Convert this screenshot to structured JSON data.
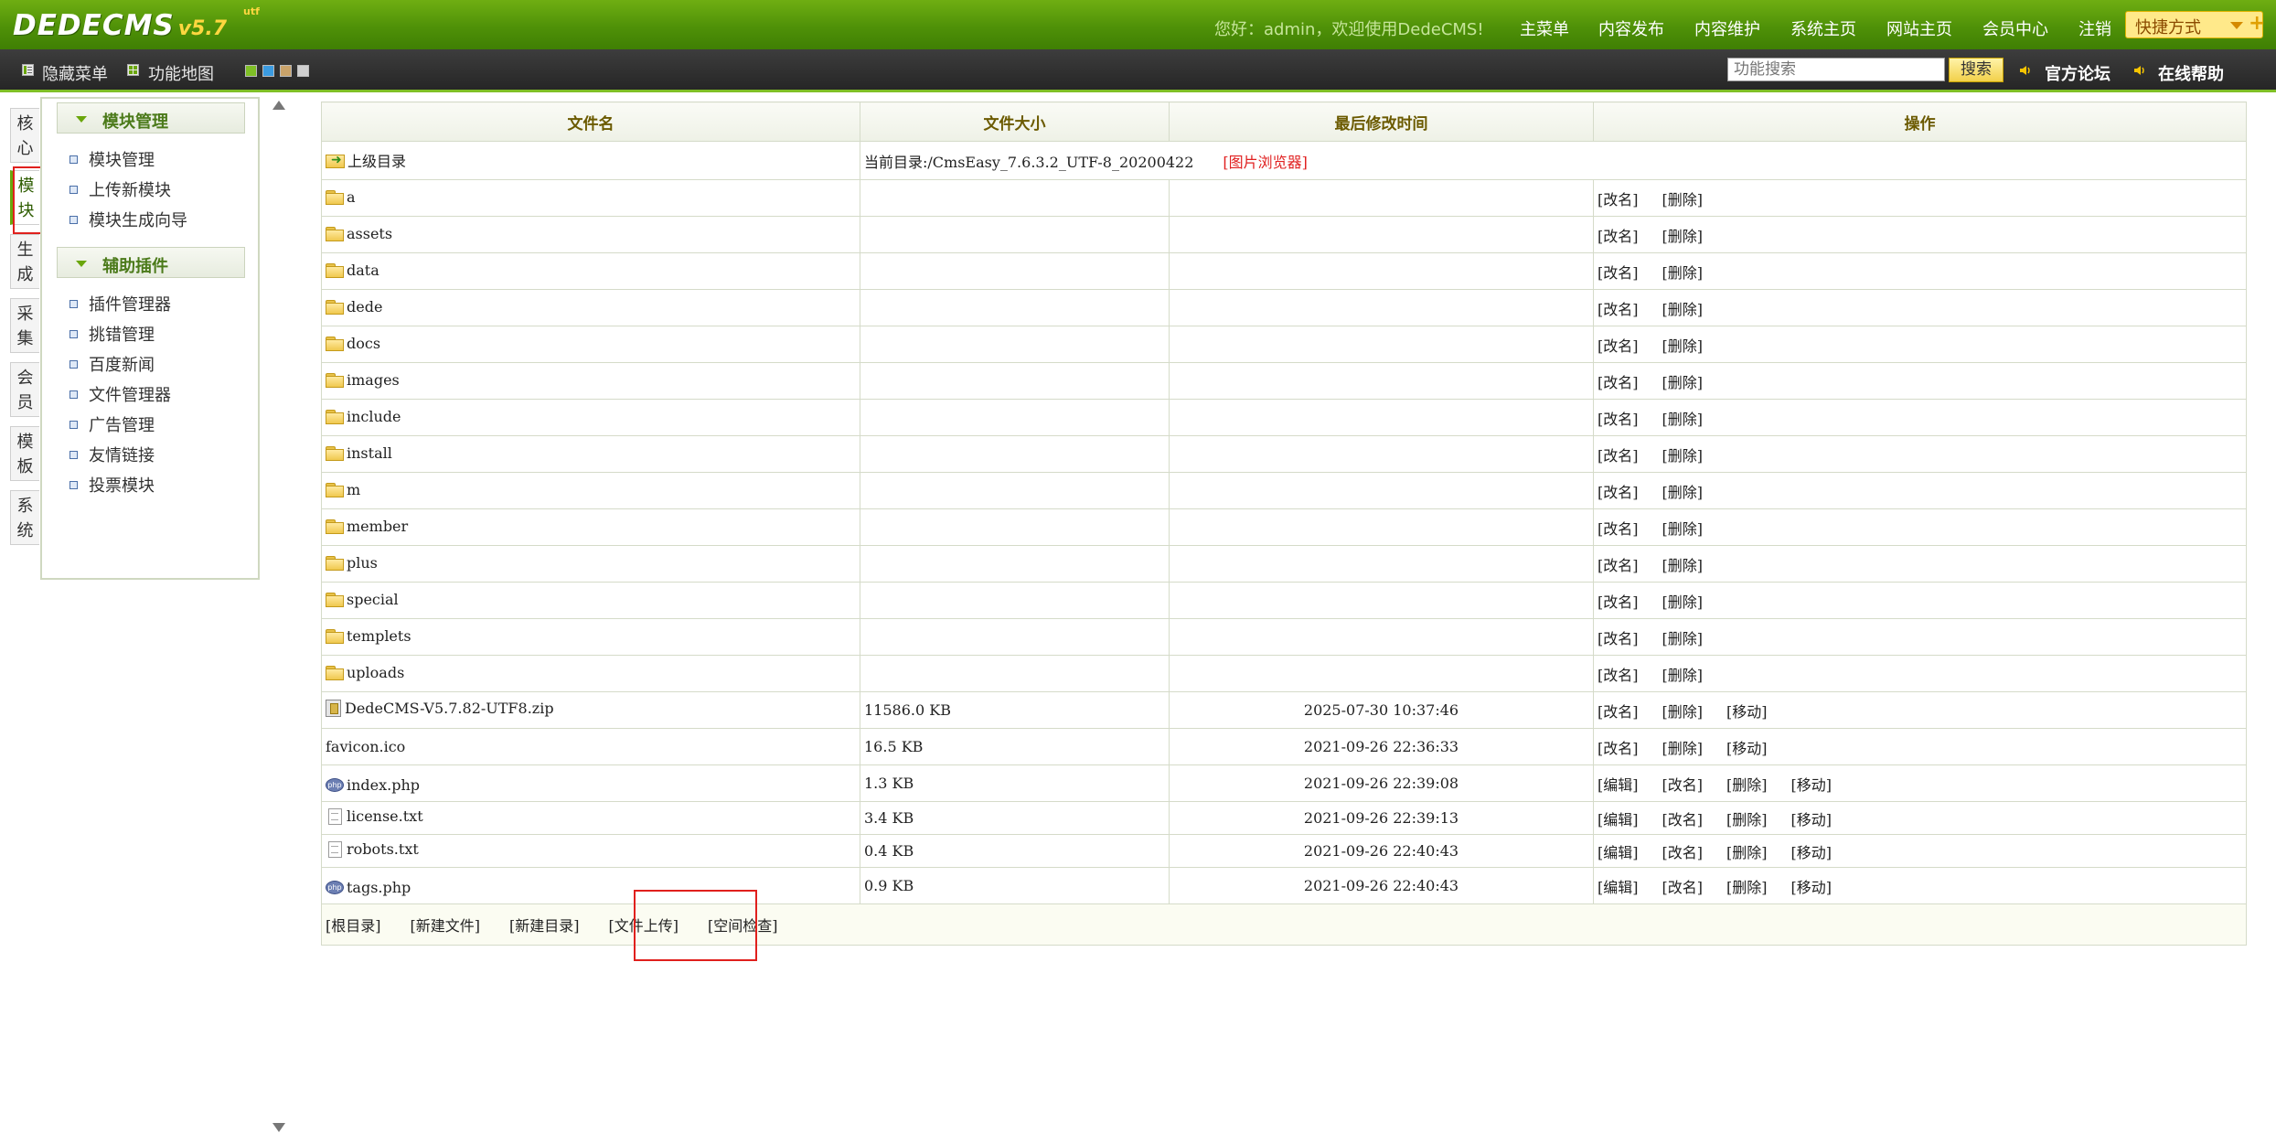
{
  "header": {
    "logo_name": "DEDECMS",
    "logo_version": "v5.7",
    "logo_sup": "utf",
    "welcome": "您好：admin，欢迎使用DedeCMS!",
    "nav": [
      "主菜单",
      "内容发布",
      "内容维护",
      "系统主页",
      "网站主页",
      "会员中心",
      "注销"
    ],
    "quick_menu": "快捷方式"
  },
  "subbar": {
    "hide_menu": "隐藏菜单",
    "site_map": "功能地图",
    "skin_colors": [
      "#7fbf26",
      "#3b9be0",
      "#c9a36a",
      "#cfcfcf"
    ],
    "search_placeholder": "功能搜索",
    "search_button": "搜索",
    "forum": "官方论坛",
    "help": "在线帮助"
  },
  "side_tabs": [
    "核心",
    "模块",
    "生成",
    "采集",
    "会员",
    "模板",
    "系统"
  ],
  "menu": {
    "section1_title": "模块管理",
    "section1_items": [
      "模块管理",
      "上传新模块",
      "模块生成向导"
    ],
    "section2_title": "辅助插件",
    "section2_items": [
      "插件管理器",
      "挑错管理",
      "百度新闻",
      "文件管理器",
      "广告管理",
      "友情链接",
      "投票模块"
    ]
  },
  "table": {
    "headers": [
      "文件名",
      "文件大小",
      "最后修改时间",
      "操作"
    ],
    "parent_dir": "上级目录",
    "current_dir": "当前目录:/CmsEasy_7.6.3.2_UTF-8_20200422",
    "image_browser": "[图片浏览器]",
    "folders": [
      "a",
      "assets",
      "data",
      "dede",
      "docs",
      "images",
      "include",
      "install",
      "m",
      "member",
      "plus",
      "special",
      "templets",
      "uploads"
    ],
    "folder_ops": [
      "[改名]",
      "[删除]"
    ],
    "files": [
      {
        "name": "DedeCMS-V5.7.82-UTF8.zip",
        "icon": "zip-icon",
        "size": "11586.0 KB",
        "time": "2025-07-30 10:37:46",
        "ops": [
          "[改名]",
          "[删除]",
          "[移动]"
        ]
      },
      {
        "name": "favicon.ico",
        "icon": "none",
        "size": "16.5 KB",
        "time": "2021-09-26 22:36:33",
        "ops": [
          "[改名]",
          "[删除]",
          "[移动]"
        ]
      },
      {
        "name": "index.php",
        "icon": "php-icon",
        "size": "1.3 KB",
        "time": "2021-09-26 22:39:08",
        "ops": [
          "[编辑]",
          "[改名]",
          "[删除]",
          "[移动]"
        ]
      },
      {
        "name": "license.txt",
        "icon": "txt-icon",
        "size": "3.4 KB",
        "time": "2021-09-26 22:39:13",
        "ops": [
          "[编辑]",
          "[改名]",
          "[删除]",
          "[移动]"
        ]
      },
      {
        "name": "robots.txt",
        "icon": "txt-icon",
        "size": "0.4 KB",
        "time": "2021-09-26 22:40:43",
        "ops": [
          "[编辑]",
          "[改名]",
          "[删除]",
          "[移动]"
        ]
      },
      {
        "name": "tags.php",
        "icon": "php-icon",
        "size": "0.9 KB",
        "time": "2021-09-26 22:40:43",
        "ops": [
          "[编辑]",
          "[改名]",
          "[删除]",
          "[移动]"
        ]
      }
    ],
    "footer_links": [
      "[根目录]",
      "[新建文件]",
      "[新建目录]",
      "[文件上传]",
      "[空间检查]"
    ]
  }
}
